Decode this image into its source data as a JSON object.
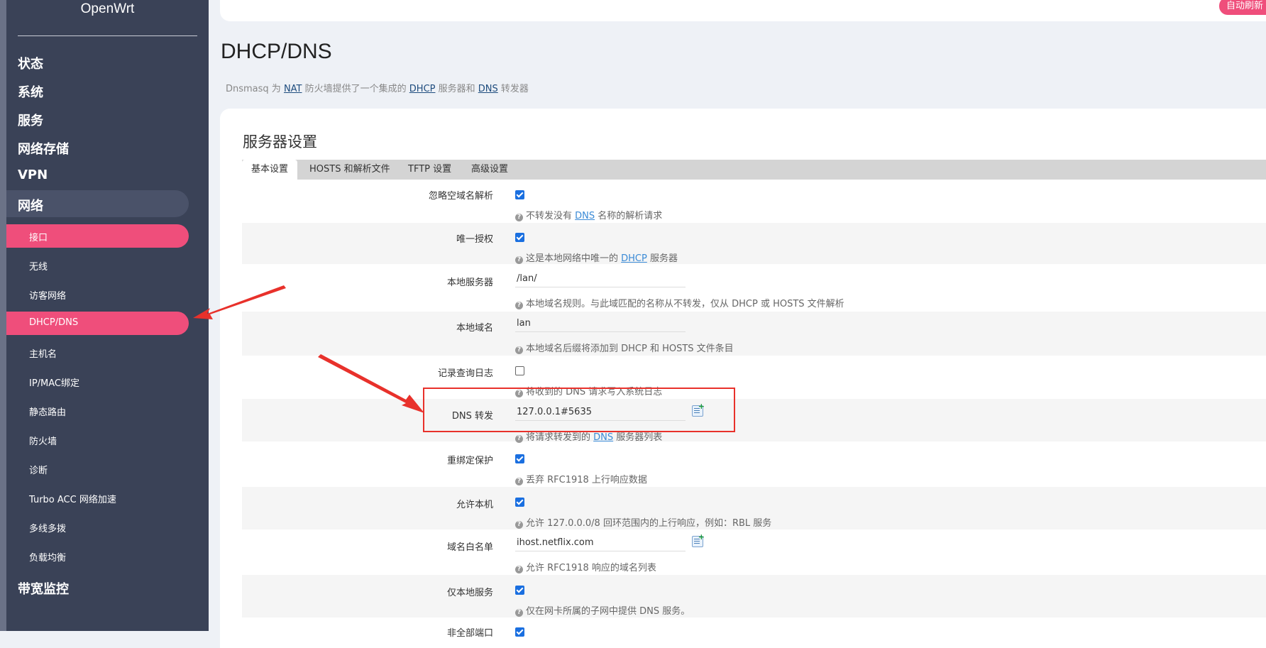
{
  "sidebar": {
    "brand": "OpenWrt",
    "main_items": [
      "状态",
      "系统",
      "服务",
      "网络存储",
      "VPN",
      "网络",
      "带宽监控"
    ],
    "sub_items": [
      "接口",
      "无线",
      "访客网络",
      "DHCP/DNS",
      "主机名",
      "IP/MAC绑定",
      "静态路由",
      "防火墙",
      "诊断",
      "Turbo ACC 网络加速",
      "多线多拨",
      "负载均衡"
    ]
  },
  "header": {
    "refresh_label": "自动刷新"
  },
  "page": {
    "title": "DHCP/DNS",
    "desc_pre": "Dnsmasq 为 ",
    "desc_nat": "NAT",
    "desc_mid1": " 防火墙提供了一个集成的 ",
    "desc_dhcp": "DHCP",
    "desc_mid2": " 服务器和 ",
    "desc_dns": "DNS",
    "desc_post": " 转发器"
  },
  "section": {
    "title": "服务器设置",
    "tabs": [
      "基本设置",
      "HOSTS 和解析文件",
      "TFTP 设置",
      "高级设置"
    ]
  },
  "fields": {
    "domainneeded": {
      "label": "忽略空域名解析",
      "checked": true,
      "hint_pre": "不转发没有 ",
      "hint_link": "DNS",
      "hint_post": " 名称的解析请求"
    },
    "authoritative": {
      "label": "唯一授权",
      "checked": true,
      "hint_pre": "这是本地网络中唯一的 ",
      "hint_link": "DHCP",
      "hint_post": " 服务器"
    },
    "local": {
      "label": "本地服务器",
      "value": "/lan/",
      "hint": "本地域名规则。与此域匹配的名称从不转发，仅从 DHCP 或 HOSTS 文件解析"
    },
    "domain": {
      "label": "本地域名",
      "value": "lan",
      "hint": "本地域名后缀将添加到 DHCP 和 HOSTS 文件条目"
    },
    "logqueries": {
      "label": "记录查询日志",
      "checked": false,
      "hint": "将收到的 DNS 请求写入系统日志"
    },
    "server": {
      "label": "DNS 转发",
      "value": "127.0.0.1#5635",
      "hint_pre": "将请求转发到的 ",
      "hint_link": "DNS",
      "hint_post": " 服务器列表"
    },
    "rebind": {
      "label": "重绑定保护",
      "checked": true,
      "hint": "丢弃 RFC1918 上行响应数据"
    },
    "localhost": {
      "label": "允许本机",
      "checked": true,
      "hint": "允许 127.0.0.0/8 回环范围内的上行响应，例如：RBL 服务"
    },
    "rebind_domain": {
      "label": "域名白名单",
      "value": "ihost.netflix.com",
      "hint": "允许 RFC1918 响应的域名列表"
    },
    "localservice": {
      "label": "仅本地服务",
      "checked": true,
      "hint": "仅在网卡所属的子网中提供 DNS 服务。"
    },
    "nonwildcard": {
      "label": "非全部端口",
      "checked": true
    }
  },
  "colors": {
    "accent": "#ef4e7b",
    "sidebar": "#3a4257",
    "annotation": "#e8312b"
  }
}
